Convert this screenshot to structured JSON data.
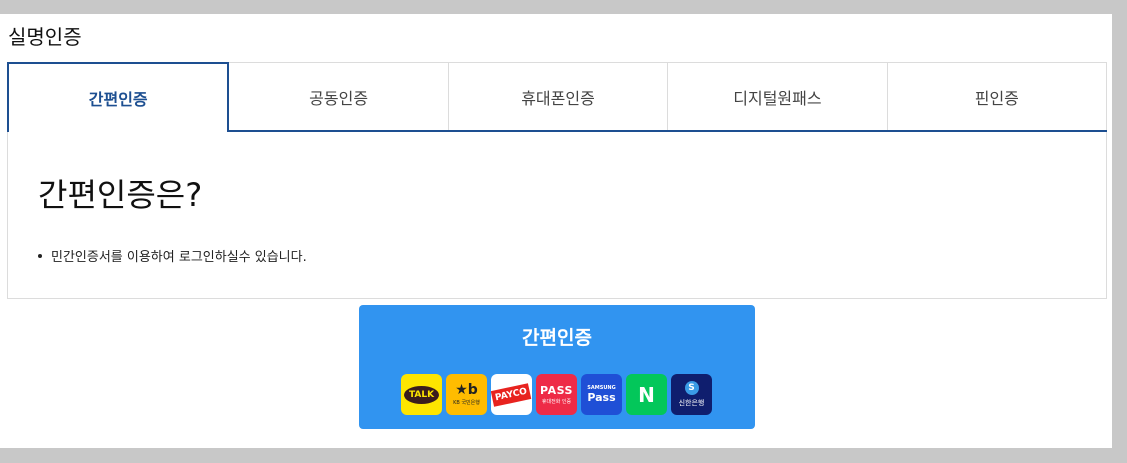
{
  "page": {
    "title": "실명인증"
  },
  "tabs": [
    {
      "label": "간편인증",
      "active": true
    },
    {
      "label": "공동인증",
      "active": false
    },
    {
      "label": "휴대폰인증",
      "active": false
    },
    {
      "label": "디지털원패스",
      "active": false
    },
    {
      "label": "핀인증",
      "active": false
    }
  ],
  "content": {
    "heading": "간편인증은?",
    "description": "민간인증서를 이용하여 로그인하실수 있습니다."
  },
  "auth_button": {
    "label": "간편인증",
    "providers": {
      "kakao": {
        "text": "TALK"
      },
      "kb": {
        "logo": "★b",
        "sub": "KB 국민은행"
      },
      "payco": {
        "text": "PAYCO"
      },
      "pass": {
        "logo": "PASS",
        "sub": "휴대전화 인증"
      },
      "samsung_pass": {
        "sub": "SAMSUNG",
        "logo": "Pass"
      },
      "naver": {
        "logo": "N"
      },
      "shinhan": {
        "logo": "S",
        "sub": "신한은행"
      }
    }
  },
  "colors": {
    "accent": "#1d4f91",
    "button": "#3194f0",
    "background": "#c8c8c8"
  }
}
